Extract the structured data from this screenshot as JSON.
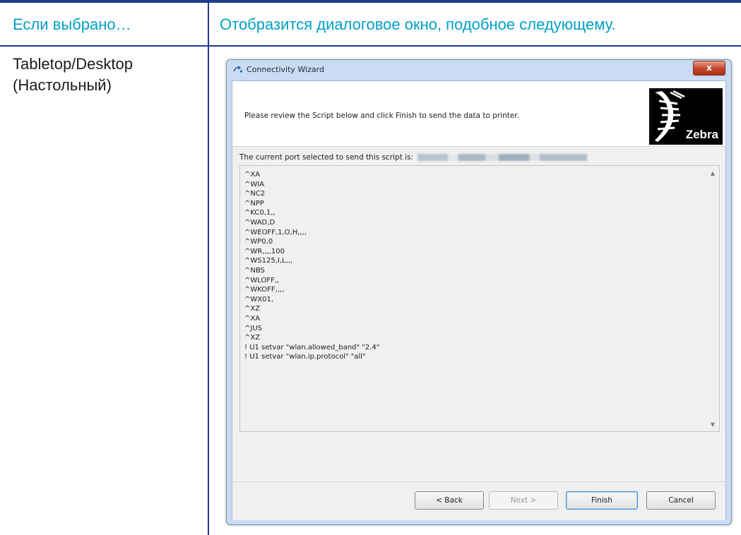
{
  "table": {
    "col1_header": "Если выбрано…",
    "col2_header": "Отобразится диалоговое окно, подобное следующему.",
    "row1_option_line1": "Tabletop/Desktop",
    "row1_option_line2": "(Настольный)"
  },
  "colors": {
    "header_text": "#00a0c6",
    "rule": "#1f3d8f"
  },
  "dialog": {
    "title": "Connectivity Wizard",
    "close_label": "x",
    "instruction": "Please review the Script below and click Finish to send the data to printer.",
    "logo_text": "Zebra",
    "port_label": "The current port selected to send this script is:",
    "script_lines": [
      "^XA",
      "^WIA",
      "^NC2",
      "^NPP",
      "^KC0,1,,",
      "^WAD,D",
      "^WEOFF,1,O,H,,,,",
      "^WP0,0",
      "^WR,,,,100",
      "^WS125,I,L,,,",
      "^NBS",
      "^WLOFF,,",
      "^WKOFF,,,,",
      "^WX01,",
      "^XZ",
      "^XA",
      "^JUS",
      "^XZ",
      "! U1 setvar \"wlan.allowed_band\" \"2.4\"",
      "! U1 setvar \"wlan.ip.protocol\" \"all\""
    ],
    "buttons": {
      "back": "< Back",
      "next": "Next >",
      "finish": "Finish",
      "cancel": "Cancel"
    }
  }
}
